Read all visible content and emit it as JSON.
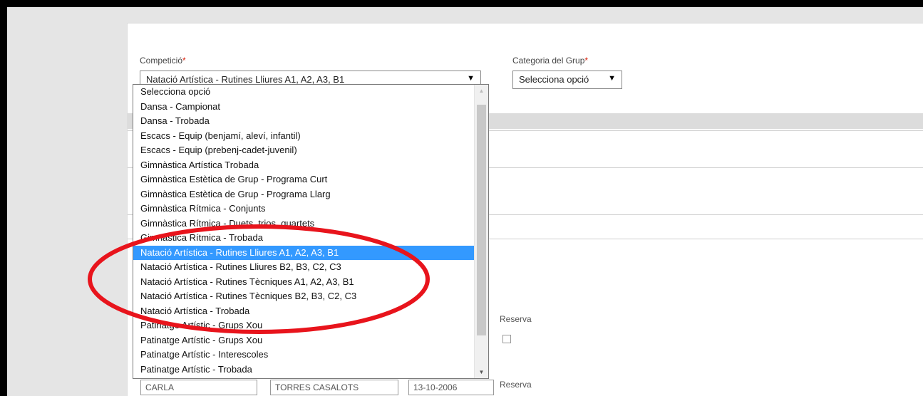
{
  "form": {
    "competition_label": "Competició",
    "competition_required": "*",
    "competition_value": "Natació Artística - Rutines Lliures A1, A2, A3, B1",
    "group_category_label": "Categoria del Grup",
    "group_category_required": "*",
    "group_category_value": "Selecciona opció",
    "arrow_glyph": "▼"
  },
  "dropdown": {
    "options": [
      "Selecciona opció",
      "Dansa - Campionat",
      "Dansa - Trobada",
      "Escacs - Equip (benjamí, aleví, infantil)",
      "Escacs - Equip (prebenj-cadet-juvenil)",
      "Gimnàstica Artística Trobada",
      "Gimnàstica Estètica de Grup - Programa Curt",
      "Gimnàstica Estètica de Grup - Programa Llarg",
      "Gimnàstica Rítmica - Conjunts",
      "Gimnàstica Rítmica - Duets, trios, quartets",
      "Gimnàstica Rítmica - Trobada",
      "Natació Artística - Rutines Lliures A1, A2, A3, B1",
      "Natació Artística - Rutines Lliures B2, B3, C2, C3",
      "Natació Artística - Rutines Tècniques A1, A2, A3, B1",
      "Natació Artística - Rutines Tècniques B2, B3, C2, C3",
      "Natació Artística - Trobada",
      "Patinatge Artístic - Grups Xou",
      "Patinatge Artístic - Grups Xou",
      "Patinatge Artístic - Interescoles",
      "Patinatge Artístic - Trobada"
    ],
    "selected_index": 11,
    "scroll_up_glyph": "▲",
    "scroll_down_glyph": "▼"
  },
  "background": {
    "reserva_label_1": "Reserva",
    "reserva_label_2": "Reserva",
    "row_first_name": "CARLA",
    "row_last_name": "TORRES CASALOTS",
    "row_date": "13-10-2006"
  },
  "colors": {
    "highlight": "#3399ff",
    "annotation": "#e8141c",
    "required": "#d9230f"
  }
}
